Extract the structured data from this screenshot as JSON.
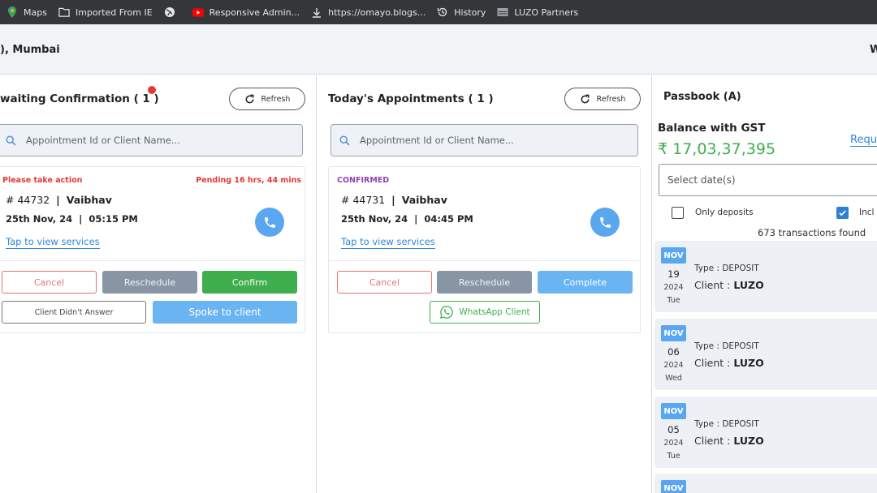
{
  "bookmarks": [
    {
      "label": "Maps",
      "icon": "maps-pin-icon"
    },
    {
      "label": "Imported From IE",
      "icon": "folder-icon"
    },
    {
      "label": "",
      "icon": "globe-icon"
    },
    {
      "label": "Responsive Admin...",
      "icon": "youtube-icon"
    },
    {
      "label": "https://omayo.blogs...",
      "icon": "download-icon"
    },
    {
      "label": "History",
      "icon": "history-icon"
    },
    {
      "label": "LUZO Partners",
      "icon": "site-favicon-icon"
    }
  ],
  "header": {
    "location": "), Mumbai",
    "right_initial": "W"
  },
  "awaiting": {
    "title": "waiting Confirmation ( 1 )",
    "refresh_label": "Refresh",
    "search_placeholder": "Appointment Id or Client Name...",
    "card": {
      "status": "Please take action",
      "pending": "Pending 16 hrs, 44 mins",
      "id": "# 44732",
      "sep": "|",
      "client": "Vaibhav",
      "date": "25th Nov, 24",
      "time": "05:15 PM",
      "link": "Tap to view services",
      "cancel": "Cancel",
      "reschedule": "Reschedule",
      "confirm": "Confirm",
      "no_answer": "Client Didn't Answer",
      "spoke": "Spoke to client"
    }
  },
  "today": {
    "title": "Today's Appointments ( 1 )",
    "refresh_label": "Refresh",
    "search_placeholder": "Appointment Id or Client Name...",
    "card": {
      "status": "CONFIRMED",
      "id": "# 44731",
      "sep": "|",
      "client": "Vaibhav",
      "date": "25th Nov, 24",
      "time": "04:45 PM",
      "link": "Tap to view services",
      "cancel": "Cancel",
      "reschedule": "Reschedule",
      "complete": "Complete",
      "whatsapp": "WhatsApp Client"
    }
  },
  "passbook": {
    "title": "Passbook (A)",
    "balance_label": "Balance with GST",
    "balance": "₹ 17,03,37,395",
    "request_link": "Requ",
    "date_placeholder": "Select date(s)",
    "only_deposits": "Only deposits",
    "only_deposits_checked": false,
    "include_label": "Incl",
    "include_checked": true,
    "txn_count": "673 transactions found",
    "transactions": [
      {
        "month": "NOV",
        "day": "19",
        "year": "2024",
        "weekday": "Tue",
        "type": "Type : DEPOSIT",
        "client_label": "Client :",
        "client": "LUZO"
      },
      {
        "month": "NOV",
        "day": "06",
        "year": "2024",
        "weekday": "Wed",
        "type": "Type : DEPOSIT",
        "client_label": "Client :",
        "client": "LUZO"
      },
      {
        "month": "NOV",
        "day": "05",
        "year": "2024",
        "weekday": "Tue",
        "type": "Type : DEPOSIT",
        "client_label": "Client :",
        "client": "LUZO"
      },
      {
        "month": "NOV"
      }
    ]
  },
  "colors": {
    "accent_blue": "#5aa7f0",
    "green": "#3fae4d",
    "danger": "#e53935",
    "confirmed_purple": "#8e44ad"
  }
}
